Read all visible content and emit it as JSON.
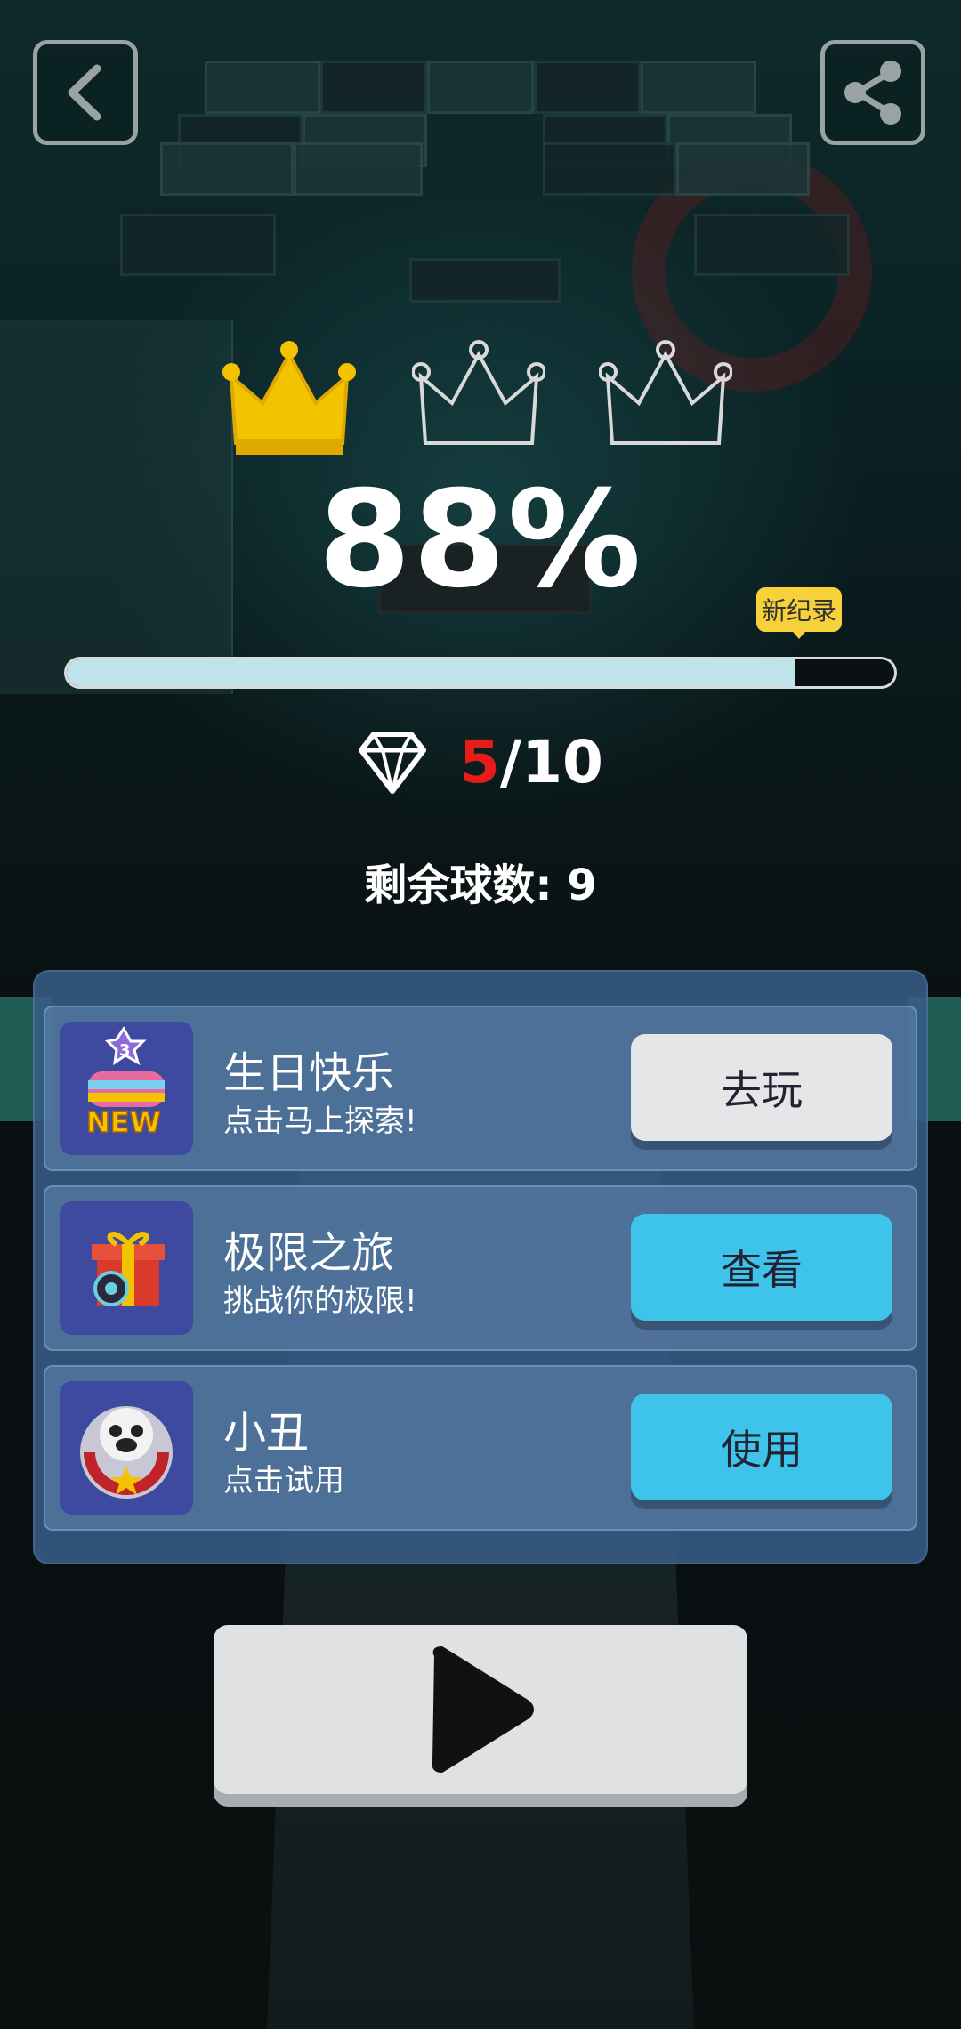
{
  "game": {
    "progress_value": 0.88,
    "progress_label": "88%",
    "new_record_label": "新纪录",
    "gems": {
      "collected": "5",
      "separator": "/",
      "total": "10"
    },
    "balls_left_label": "剩余球数: 9",
    "crowns": [
      {
        "earned": true,
        "color": "#f4c300"
      },
      {
        "earned": false,
        "color": "#d9d9d9"
      },
      {
        "earned": false,
        "color": "#d9d9d9"
      }
    ]
  },
  "promos": [
    {
      "title": "生日快乐",
      "subtitle": "点击马上探索!",
      "button": "去玩",
      "button_color": "#e4e6e7",
      "icon": "new-ball-pack-icon",
      "badge": "3",
      "badge_text": "NEW"
    },
    {
      "title": "极限之旅",
      "subtitle": "挑战你的极限!",
      "button": "查看",
      "button_color": "#3ec4ea",
      "icon": "gift-box-icon"
    },
    {
      "title": "小丑",
      "subtitle": "点击试用",
      "button": "使用",
      "button_color": "#3ec4ea",
      "icon": "clown-ball-icon"
    }
  ],
  "icons": {
    "back": "back-icon",
    "share": "share-icon",
    "play": "play-icon",
    "diamond": "diamond-icon",
    "crown": "crown-icon"
  },
  "colors": {
    "accent_cyan": "#3ec4ea",
    "gold": "#f4c300",
    "gem_red": "#e81b1b",
    "panel": "#385c86"
  }
}
